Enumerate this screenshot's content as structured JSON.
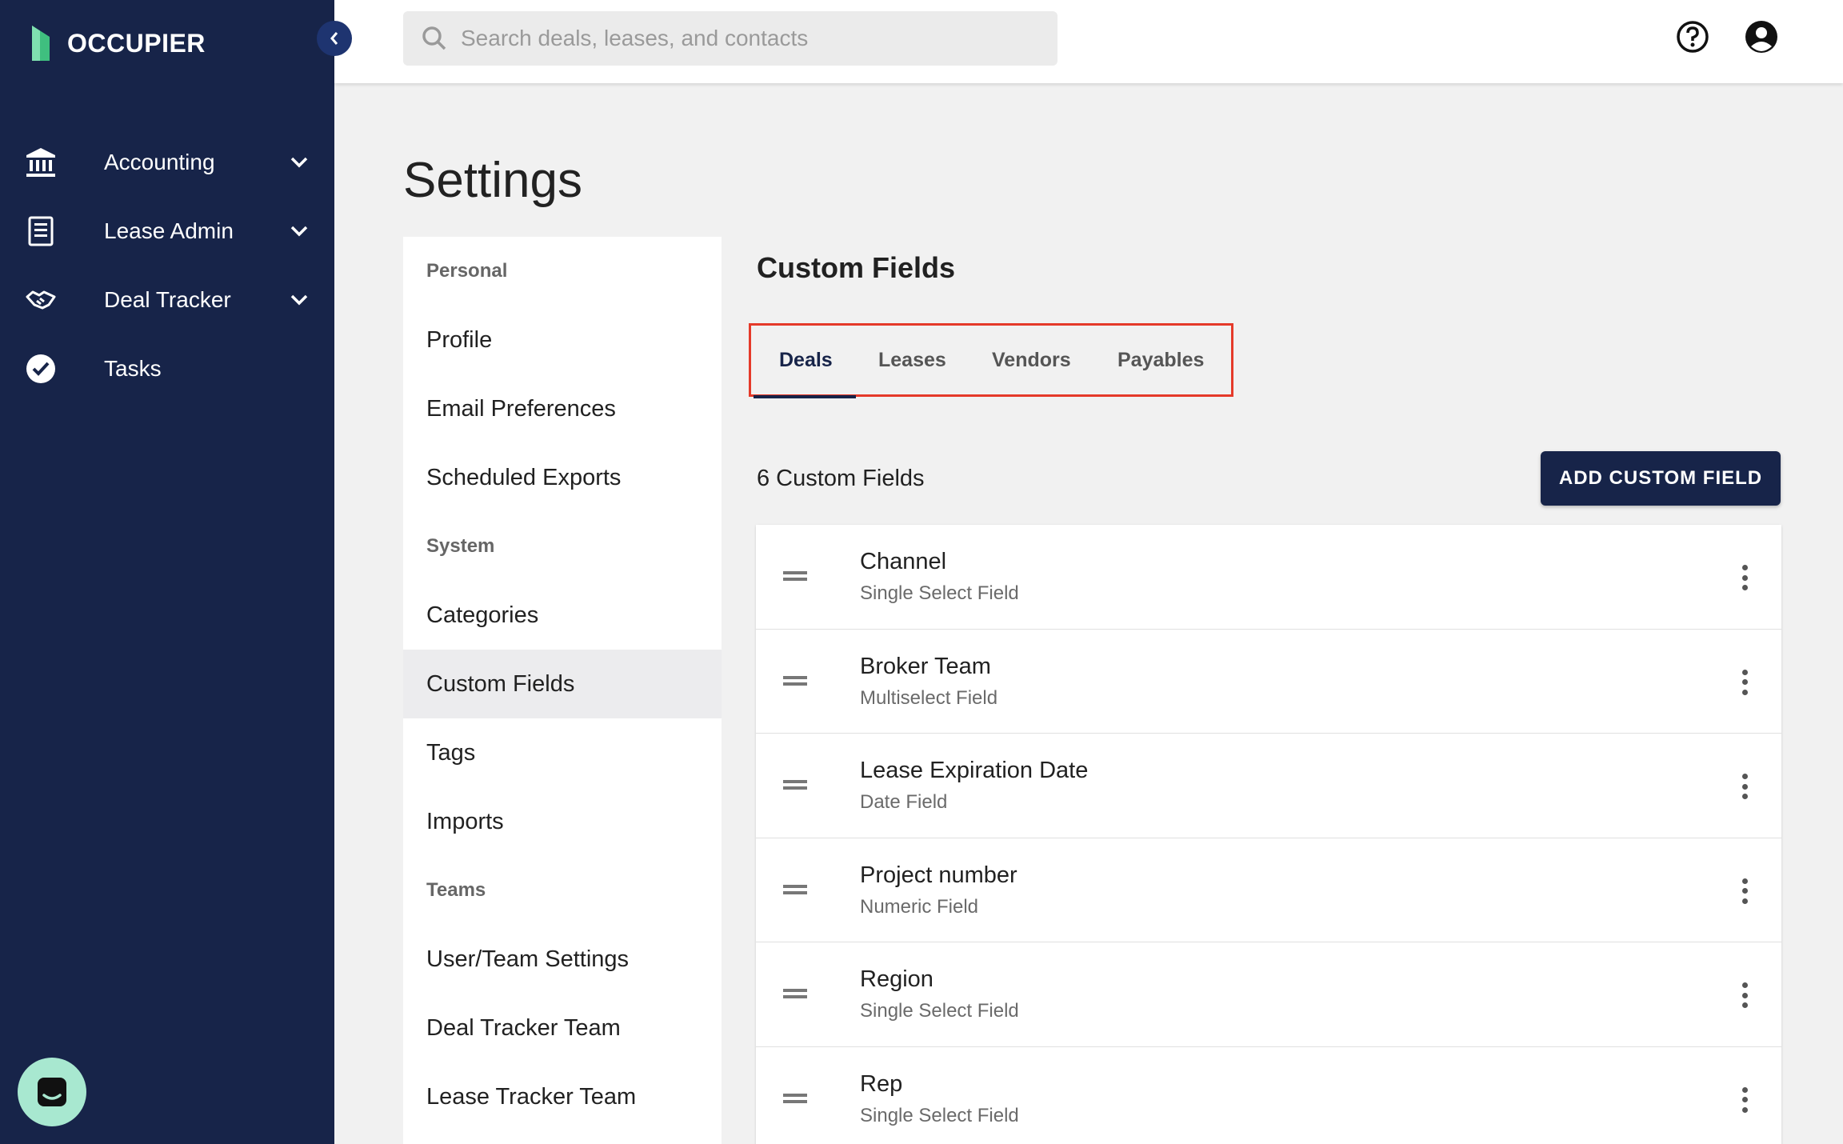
{
  "app": {
    "name": "OCCUPIER",
    "brand_color": "#172449",
    "accent_green": "#3fbf7f",
    "highlight_color": "#e53a2a"
  },
  "sidebar": {
    "items": [
      {
        "label": "Accounting",
        "icon": "bank-icon",
        "has_chevron": true
      },
      {
        "label": "Lease Admin",
        "icon": "document-icon",
        "has_chevron": true
      },
      {
        "label": "Deal Tracker",
        "icon": "handshake-icon",
        "has_chevron": true
      },
      {
        "label": "Tasks",
        "icon": "check-circle-icon",
        "has_chevron": false
      }
    ]
  },
  "topbar": {
    "search_placeholder": "Search deals, leases, and contacts"
  },
  "page": {
    "title": "Settings"
  },
  "settings_menu": {
    "sections": [
      {
        "title": "Personal",
        "items": [
          "Profile",
          "Email Preferences",
          "Scheduled Exports"
        ]
      },
      {
        "title": "System",
        "items": [
          "Categories",
          "Custom Fields",
          "Tags",
          "Imports"
        ]
      },
      {
        "title": "Teams",
        "items": [
          "User/Team Settings",
          "Deal Tracker Team",
          "Lease Tracker Team"
        ]
      }
    ],
    "active_item": "Custom Fields"
  },
  "panel": {
    "title": "Custom Fields",
    "tabs": [
      "Deals",
      "Leases",
      "Vendors",
      "Payables"
    ],
    "active_tab": "Deals",
    "count_label": "6 Custom Fields",
    "add_button": "ADD CUSTOM FIELD",
    "fields": [
      {
        "name": "Channel",
        "type": "Single Select Field"
      },
      {
        "name": "Broker Team",
        "type": "Multiselect Field"
      },
      {
        "name": "Lease Expiration Date",
        "type": "Date Field"
      },
      {
        "name": "Project number",
        "type": "Numeric Field"
      },
      {
        "name": "Region",
        "type": "Single Select Field"
      },
      {
        "name": "Rep",
        "type": "Single Select Field"
      }
    ]
  }
}
